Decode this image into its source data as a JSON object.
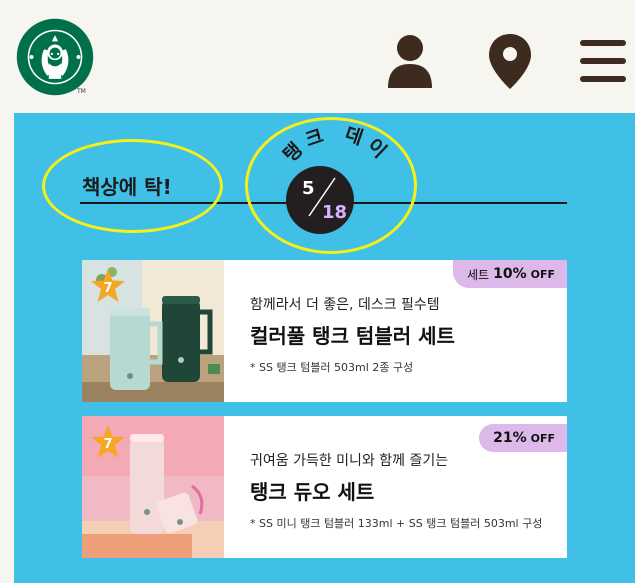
{
  "header": {
    "logo_alt": "Starbucks",
    "tm": "TM",
    "icons": [
      "user-icon",
      "location-pin-icon",
      "hamburger-menu-icon"
    ]
  },
  "promo": {
    "title": "책상에 탁!",
    "event_name": "탱크 데이",
    "date_month": "5",
    "date_day": "18"
  },
  "products": [
    {
      "rank": "7",
      "badge_text": "세트",
      "badge_pct": "10%",
      "badge_off": "OFF",
      "subtitle": "함께라서 더 좋은, 데스크 필수템",
      "title": "컬러풀 탱크 텀블러 세트",
      "note": "* SS 탱크 텀블러 503ml 2종 구성"
    },
    {
      "rank": "7",
      "badge_text": "",
      "badge_pct": "21%",
      "badge_off": "OFF",
      "subtitle": "귀여움 가득한 미니와 함께 즐기는",
      "title": "탱크 듀오 세트",
      "note": "* SS 미니 탱크 텀블러 133ml + SS 탱크 텀블러 503ml 구성"
    }
  ],
  "colors": {
    "background_header": "#f6f5f0",
    "promo_bg": "#40c0e6",
    "badge_bg": "#ddb9ea",
    "highlight_oval": "#f6f01a",
    "starbucks_green": "#00704a",
    "icon_dark": "#3d2b1f"
  }
}
